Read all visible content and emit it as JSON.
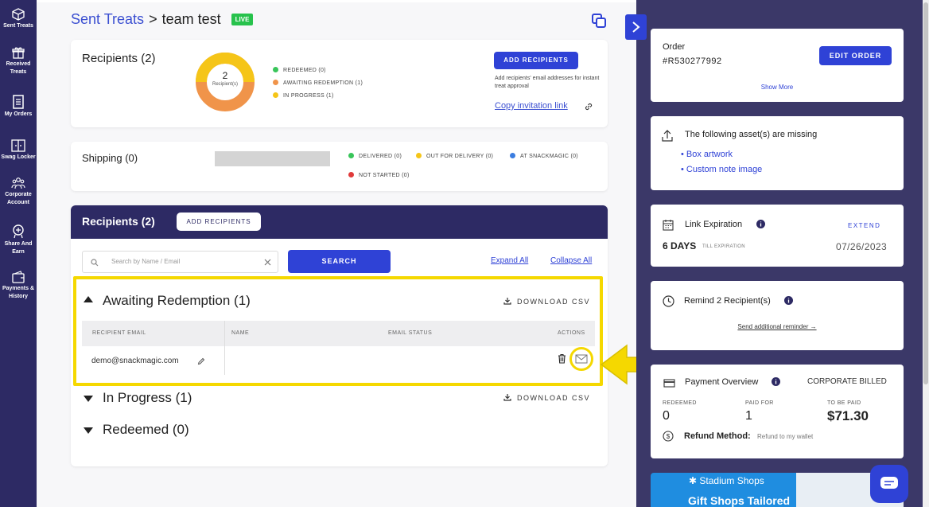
{
  "nav": {
    "items": [
      {
        "label": "Sent Treats",
        "icon": "box-icon"
      },
      {
        "label": "Received Treats",
        "icon": "gift-icon"
      },
      {
        "label": "My Orders",
        "icon": "orders-icon"
      },
      {
        "label": "Swag Locker",
        "icon": "locker-icon"
      },
      {
        "label": "Corporate Account",
        "icon": "team-icon"
      },
      {
        "label": "Share And Earn",
        "icon": "share-icon"
      },
      {
        "label": "Payments & History",
        "icon": "payments-icon"
      }
    ]
  },
  "header": {
    "breadcrumb_link": "Sent Treats",
    "separator": ">",
    "current": "team test",
    "badge": "LIVE"
  },
  "summary": {
    "title": "Recipients (2)",
    "donut_count": "2",
    "donut_sub": "Recipient(s)",
    "legend": [
      {
        "label": "REDEEMED (0)",
        "color": "#39c55a"
      },
      {
        "label": "AWAITING REDEMPTION (1)",
        "color": "#f0944a"
      },
      {
        "label": "IN PROGRESS (1)",
        "color": "#f5c518"
      }
    ],
    "add_button": "ADD RECIPIENTS",
    "add_help": "Add recipients' email addresses for instant treat approval",
    "invite_link": "Copy invitation link"
  },
  "shipping": {
    "title": "Shipping (0)",
    "legend": [
      {
        "label": "DELIVERED (0)",
        "color": "#39c55a"
      },
      {
        "label": "OUT FOR DELIVERY (0)",
        "color": "#f5c518"
      },
      {
        "label": "AT SNACKMAGIC (0)",
        "color": "#3b7de0"
      },
      {
        "label": "NOT STARTED (0)",
        "color": "#e03b3b"
      }
    ]
  },
  "recipients": {
    "title": "Recipients (2)",
    "add_button": "ADD RECIPIENTS",
    "search_placeholder": "Search by Name / Email",
    "search_button": "SEARCH",
    "expand_all": "Expand All",
    "collapse_all": "Collapse All",
    "groups": [
      {
        "title": "Awaiting Redemption (1)",
        "download": "DOWNLOAD CSV"
      },
      {
        "title": "In Progress (1)",
        "download": "DOWNLOAD CSV"
      },
      {
        "title": "Redeemed (0)"
      }
    ],
    "columns": [
      "RECIPIENT EMAIL",
      "NAME",
      "EMAIL STATUS",
      "ACTIONS"
    ],
    "rows": [
      {
        "email": "demo@snackmagic.com",
        "name": "",
        "status": ""
      }
    ]
  },
  "right": {
    "order_label": "Order",
    "order_id": "#R530277992",
    "edit_order": "EDIT ORDER",
    "show_more": "Show More",
    "missing_title": "The following asset(s) are missing",
    "missing_items": [
      "Box artwork",
      "Custom note image"
    ],
    "link_exp_title": "Link Expiration",
    "extend": "EXTEND",
    "days": "6 DAYS",
    "till": "TILL EXPIRATION",
    "exp_date": "07/26/2023",
    "remind_title": "Remind 2 Recipient(s)",
    "send_reminder": "Send additional reminder →",
    "payment_title": "Payment Overview",
    "corporate": "CORPORATE BILLED",
    "redeemed_label": "REDEEMED",
    "redeemed_val": "0",
    "paid_label": "PAID FOR",
    "paid_val": "1",
    "tobepaid_label": "TO BE PAID",
    "tobepaid_val": "$71.30",
    "refund_label": "Refund Method:",
    "refund_val": "Refund to my wallet",
    "banner_brand": "Stadium Shops",
    "banner_text": "Gift Shops Tailored"
  },
  "colors": {
    "nav_bg": "#2d2a64",
    "accent": "#2f42d6",
    "highlight": "#f5d800",
    "right_bg": "#3b3868"
  }
}
